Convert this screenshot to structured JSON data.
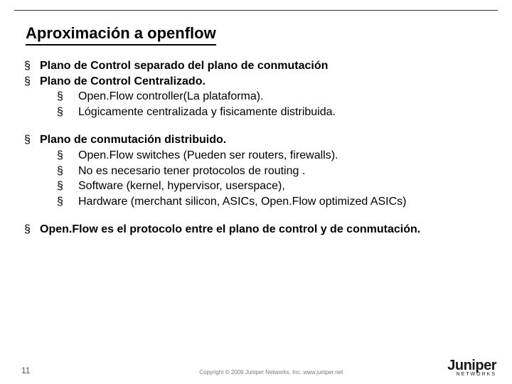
{
  "title": "Aproximación a openflow",
  "bullet_char": "§",
  "groups": [
    {
      "items": [
        {
          "text": "Plano de Control separado del plano de conmutación",
          "bold": true
        },
        {
          "text": "Plano de Control Centralizado.",
          "bold": true,
          "sub": [
            "Open.Flow controller(La plataforma).",
            "Lógicamente centralizada y fisicamente distribuida."
          ]
        }
      ]
    },
    {
      "items": [
        {
          "text": "Plano de conmutación distribuido.",
          "bold": true,
          "sub": [
            "Open.Flow switches (Pueden ser routers, firewalls).",
            "No  es necesario tener protocolos de routing .",
            "Software (kernel, hypervisor, userspace),",
            "Hardware (merchant silicon, ASICs, Open.Flow optimized ASICs)"
          ]
        }
      ]
    },
    {
      "items": [
        {
          "text": "Open.Flow  es el protocolo entre el plano de control y de conmutación.",
          "bold": true
        }
      ]
    }
  ],
  "page_number": "11",
  "copyright": "Copyright © 2009 Juniper Networks, Inc.    www.juniper.net",
  "logo": {
    "main": "Juniper",
    "sub": "NETWORKS"
  }
}
